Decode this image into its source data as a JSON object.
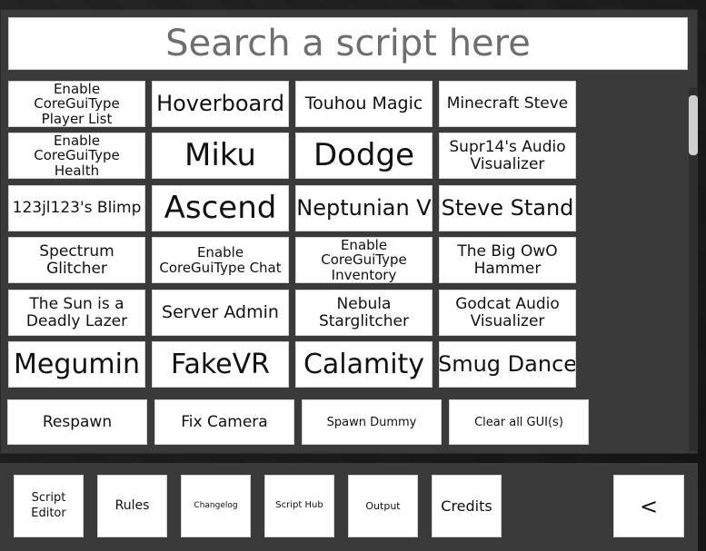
{
  "search": {
    "placeholder": "Search a script here"
  },
  "scripts": [
    [
      "Enable CoreGuiType Player List",
      "Hoverboard",
      "Touhou Magic",
      "Minecraft Steve"
    ],
    [
      "Enable CoreGuiType Health",
      "Miku",
      "Dodge",
      "Supr14's Audio Visualizer"
    ],
    [
      "123jl123's Blimp",
      "Ascend",
      "Neptunian V",
      "Steve Stand"
    ],
    [
      "Spectrum Glitcher",
      "Enable CoreGuiType Chat",
      "Enable CoreGuiType Inventory",
      "The Big OwO Hammer"
    ],
    [
      "The Sun is a Deadly Lazer",
      "Server Admin",
      "Nebula Starglitcher",
      "Godcat Audio Visualizer"
    ],
    [
      "Megumin",
      "FakeVR",
      "Calamity",
      "Smug Dance"
    ]
  ],
  "actions": [
    "Respawn",
    "Fix Camera",
    "Spawn Dummy",
    "Clear all GUI(s)"
  ],
  "nav": {
    "script_editor": "Script Editor",
    "rules": "Rules",
    "changelog": "Changelog",
    "script_hub": "Script Hub",
    "output": "Output",
    "credits": "Credits",
    "collapse": "<"
  }
}
